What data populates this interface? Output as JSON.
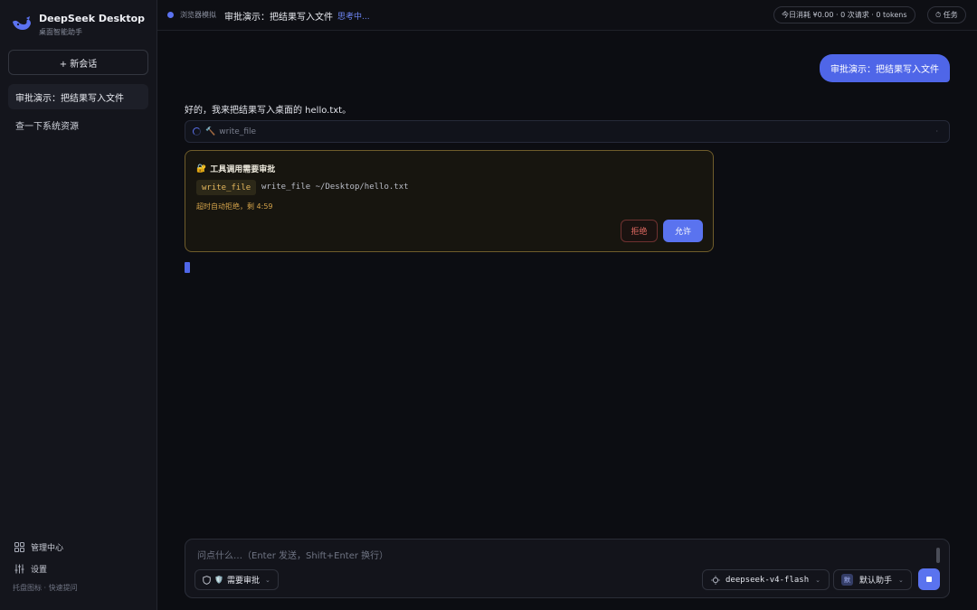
{
  "sidebar": {
    "app_name": "DeepSeek Desktop",
    "app_subtitle": "桌面智能助手",
    "new_chat_label": "+ 新会话",
    "conversations": [
      {
        "title": "审批演示：把结果写入文件",
        "active": true
      },
      {
        "title": "查一下系统资源",
        "active": false
      }
    ],
    "admin_label": "管理中心",
    "settings_label": "设置",
    "tray_hint": "托盘图标 · 快速提问"
  },
  "topbar": {
    "mode_label": "浏览器模拟",
    "conversation_title": "审批演示：把结果写入文件",
    "status_text": "思考中...",
    "usage": "今日消耗 ¥0.00 · 0 次请求 · 0 tokens",
    "tasks_label": "⏱ 任务"
  },
  "messages": {
    "user_text": "审批演示：把结果写入文件",
    "assistant_text": "好的，我来把结果写入桌面的 hello.txt。",
    "tool_name": "write_file",
    "tool_caret": "·"
  },
  "approval": {
    "title": "工具调用需要审批",
    "lock_emoji": "🔐",
    "tool_chip": "write_file",
    "command": "write_file ~/Desktop/hello.txt",
    "timeout_text": "超时自动拒绝，剩 4:59",
    "reject_label": "拒绝",
    "allow_label": "允许"
  },
  "composer": {
    "placeholder": "问点什么…（Enter 发送，Shift+Enter 换行）",
    "approval_mode_emoji": "🛡️",
    "approval_mode": "需要审批",
    "model": "deepseek-v4-flash",
    "agent_badge": "默",
    "agent": "默认助手"
  },
  "colors": {
    "accent": "#5a73ef",
    "warning_border": "#6f5c2b",
    "danger": "#e36b63",
    "background": "#0c0d12"
  }
}
